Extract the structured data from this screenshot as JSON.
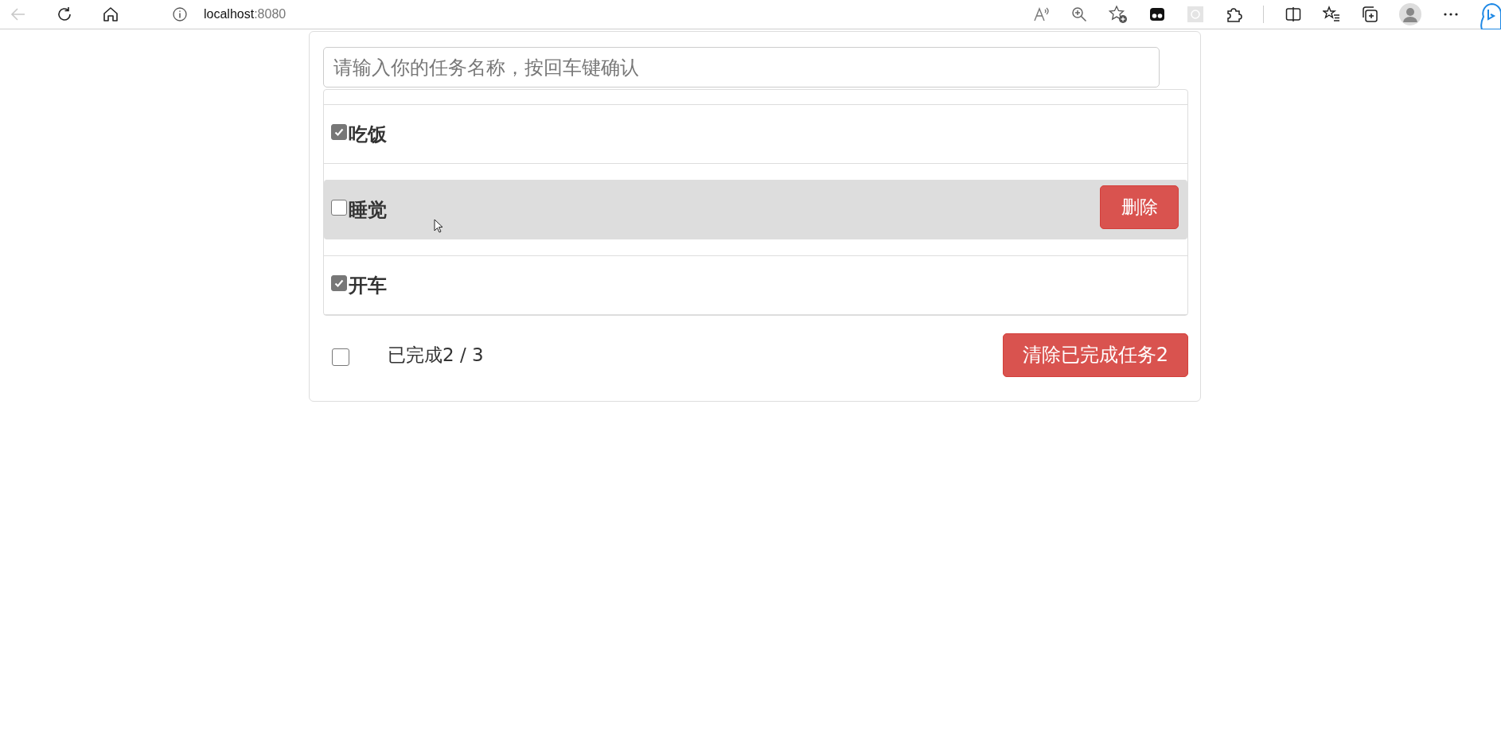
{
  "browser": {
    "host": "localhost",
    "port": ":8080"
  },
  "todo": {
    "input": {
      "placeholder": "请输入你的任务名称，按回车键确认"
    },
    "items": [
      {
        "name": "吃饭",
        "done": true,
        "hovered": false
      },
      {
        "name": "睡觉",
        "done": false,
        "hovered": true
      },
      {
        "name": "开车",
        "done": true,
        "hovered": false
      }
    ],
    "delete_label": "删除",
    "footer": {
      "all_checked": false,
      "summary": "已完成2 / 3",
      "clear_button": "清除已完成任务2"
    }
  }
}
